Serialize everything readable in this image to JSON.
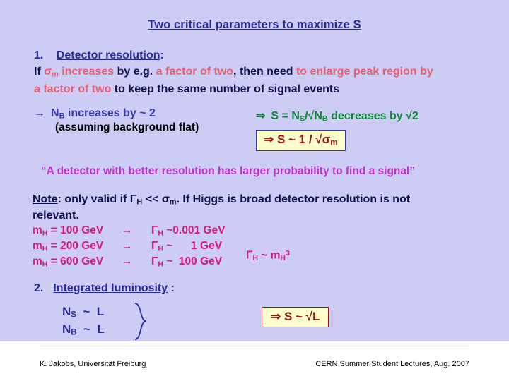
{
  "slide": {
    "title": "Two critical parameters to maximize S",
    "background_color": "#ccccf5"
  },
  "section1": {
    "number": "1.",
    "heading": "Detector resolution",
    "colon": ":",
    "line1_a": "If ",
    "line1_sigma": "σ",
    "line1_sigma_sub": "m",
    "line1_b": " increases",
    "line1_c": " by e.g. ",
    "line1_d": "a factor of two",
    "line1_e": ",  then need ",
    "line1_f": "to enlarge peak region by",
    "line2_a": "a factor of two",
    "line2_b": " to keep the same number of signal events"
  },
  "background_note": {
    "arrow": "→",
    "nb_text_a": "N",
    "nb_text_sub": "B",
    "nb_text_b": " increases by ~ 2",
    "assumption": "(assuming background flat)"
  },
  "significance": {
    "arrow": "⇒",
    "s_label": "S",
    "equals": " = N",
    "ns_sub": "S",
    "over": "/√N",
    "nb_sub": "B",
    "tail": "  decreases by √2"
  },
  "box_sigma": {
    "arrow": "⇒",
    "text_a": "  S  ~ 1 / √σ",
    "sub": "m",
    "background": "#ffffcc",
    "border_color": "#3838a8",
    "text_color": "#9b1212"
  },
  "quote": {
    "text": "“A detector with better resolution has larger probability to find a signal”",
    "color": "#c030c8"
  },
  "note": {
    "label": "Note",
    "text_a": ": only valid if  ",
    "gamma": "Γ",
    "gamma_sub": "H",
    "text_b": " << ",
    "sigma": "σ",
    "sigma_sub": "m",
    "text_c": ". If  Higgs is broad detector resolution is not",
    "line2": "relevant."
  },
  "mass_table": {
    "rows": [
      {
        "mass_sym": "m",
        "mass_sub": "H",
        "mass_val": " = 100 GeV",
        "arrow": "→",
        "width_sym": "Γ",
        "width_sub": "H",
        "width_val": " ~0.001 GeV"
      },
      {
        "mass_sym": "m",
        "mass_sub": "H",
        "mass_val": " = 200 GeV",
        "arrow": "→",
        "width_sym": "Γ",
        "width_sub": "H",
        "width_val": " ~      1 GeV"
      },
      {
        "mass_sym": "m",
        "mass_sub": "H",
        "mass_val": " = 600 GeV",
        "arrow": "→",
        "width_sym": "Γ",
        "width_sub": "H",
        "width_val": " ~  100 GeV"
      }
    ],
    "scaling": {
      "gamma": "Γ",
      "gamma_sub": "H",
      "tilde": " ~ m",
      "m_sub": "H",
      "power": "3"
    },
    "color": "#d61a7a"
  },
  "section2": {
    "number": "2.",
    "heading": "Integrated luminosity",
    "colon": " :",
    "rows": [
      {
        "sym": "N",
        "sub": "S",
        "rel": "  ~  L"
      },
      {
        "sym": "N",
        "sub": "B",
        "rel": "  ~  L"
      }
    ]
  },
  "box_lumi": {
    "arrow": "⇒",
    "text": " S ~ √L",
    "background": "#ffffcc",
    "border_color": "#9b1212",
    "text_color": "#9b1212"
  },
  "footer": {
    "left": "K. Jakobs,  Universität Freiburg",
    "right": "CERN Summer Student Lectures,  Aug. 2007"
  }
}
